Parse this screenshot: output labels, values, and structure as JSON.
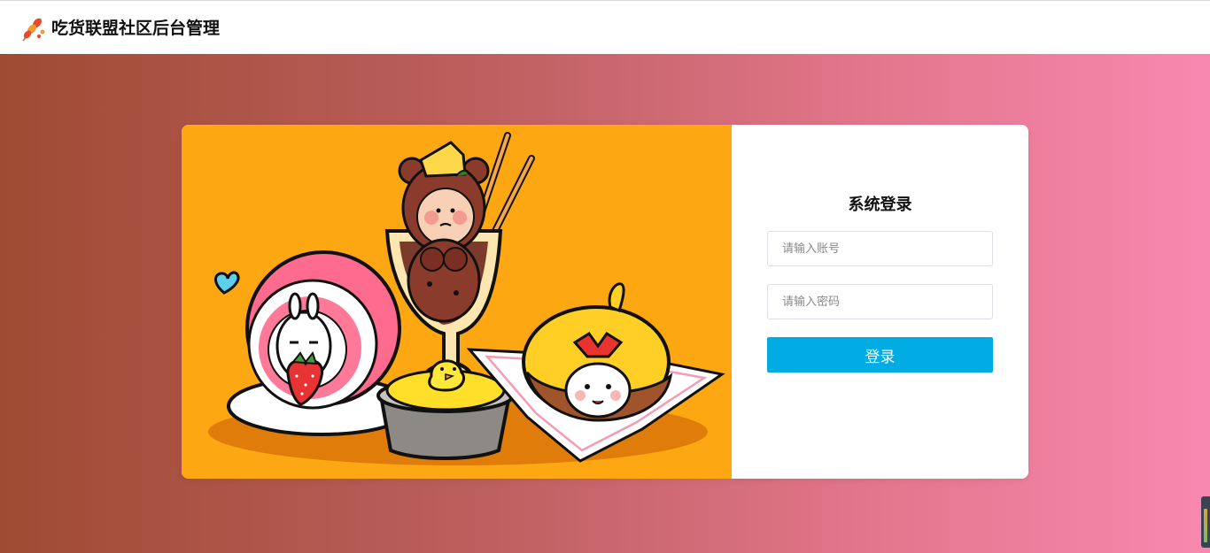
{
  "header": {
    "title": "吃货联盟社区后台管理",
    "logo_icon": "skewer-food-icon"
  },
  "colors": {
    "gradient_start": "#9f4b33",
    "gradient_end": "#f988b0",
    "illustration_bg": "#fda813",
    "button_bg": "#00ace3"
  },
  "login": {
    "title": "系统登录",
    "account_placeholder": "请输入账号",
    "password_placeholder": "请输入密码",
    "submit_label": "登录"
  }
}
